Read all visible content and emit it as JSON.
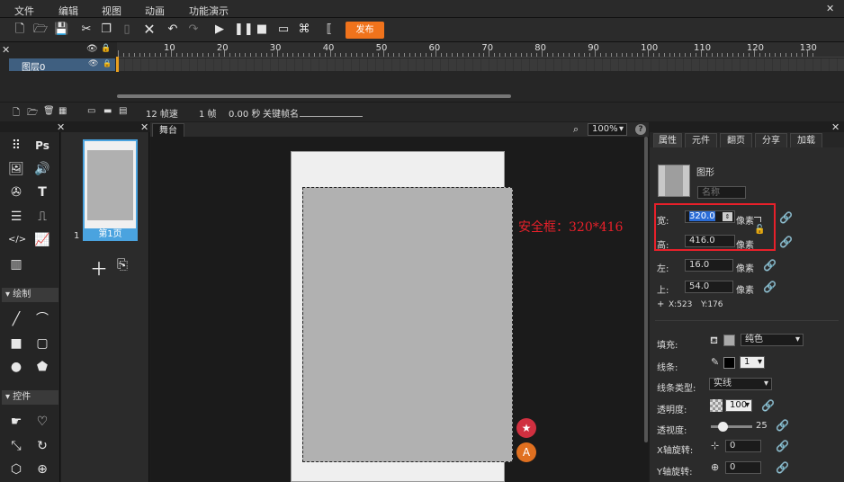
{
  "menu": [
    "文件",
    "编辑",
    "视图",
    "动画",
    "功能演示"
  ],
  "toolbar": {
    "publish_label": "发布"
  },
  "timeline": {
    "ruler": [
      "10",
      "20",
      "30",
      "40",
      "50",
      "60",
      "70",
      "80",
      "90",
      "100",
      "110",
      "120",
      "130"
    ],
    "layer_name": "图层0",
    "fps": "12 帧速",
    "frame": "1 帧",
    "time": "0.00 秒",
    "keyframe_label": "关键帧名"
  },
  "left": {
    "draw_section": "绘制",
    "controls_section": "控件"
  },
  "pages": {
    "page_number": "1",
    "page_label": "第1页"
  },
  "stage": {
    "tab": "舞台",
    "zoom": "100%",
    "safe_frame_label": "安全框：320*416"
  },
  "props": {
    "tabs": [
      "属性",
      "元件",
      "翻页",
      "分享",
      "加载"
    ],
    "type_label": "图形",
    "name_placeholder": "名称",
    "width_label": "宽:",
    "width_value": "320.0",
    "height_label": "高:",
    "height_value": "416.0",
    "left_label": "左:",
    "left_value": "16.0",
    "top_label": "上:",
    "top_value": "54.0",
    "unit": "像素",
    "coord_x": "X:523",
    "coord_y": "Y:176",
    "fill_label": "填充:",
    "fill_type": "纯色",
    "stroke_label": "线条:",
    "stroke_width": "1",
    "stroke_type_label": "线条类型:",
    "stroke_type": "实线",
    "opacity_label": "透明度:",
    "opacity_value": "100",
    "perspective_label": "透视度:",
    "perspective_value": "25",
    "xrot_label": "X轴旋转:",
    "xrot_value": "0",
    "yrot_label": "Y轴旋转:",
    "yrot_value": "0"
  },
  "colors": {
    "accent": "#f0731c",
    "selection": "#4aa3df",
    "highlight": "#e8202a"
  }
}
